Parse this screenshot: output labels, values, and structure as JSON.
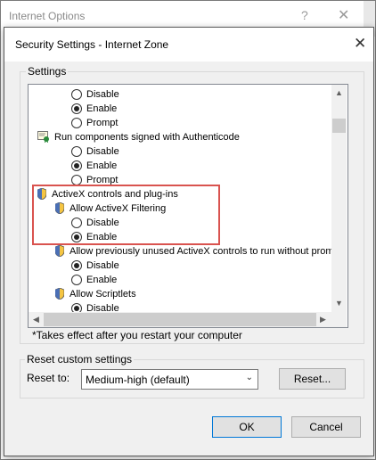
{
  "outer_window": {
    "title": "Internet Options",
    "help_glyph": "?",
    "close_glyph": "✕"
  },
  "dialog": {
    "title": "Security Settings - Internet Zone",
    "close_glyph": "✕"
  },
  "settings_group": {
    "label": "Settings"
  },
  "settings_items": [
    {
      "kind": "radio",
      "label": "Disable",
      "selected": false
    },
    {
      "kind": "radio",
      "label": "Enable",
      "selected": true
    },
    {
      "kind": "radio",
      "label": "Prompt",
      "selected": false
    },
    {
      "kind": "category",
      "label": "Run components signed with Authenticode",
      "icon": "certificate-icon"
    },
    {
      "kind": "radio",
      "label": "Disable",
      "selected": false
    },
    {
      "kind": "radio",
      "label": "Enable",
      "selected": true
    },
    {
      "kind": "radio",
      "label": "Prompt",
      "selected": false
    },
    {
      "kind": "category",
      "label": "ActiveX controls and plug-ins",
      "icon": "shield-icon"
    },
    {
      "kind": "subcategory",
      "label": "Allow ActiveX Filtering",
      "icon": "shield-icon"
    },
    {
      "kind": "radio",
      "label": "Disable",
      "selected": false
    },
    {
      "kind": "radio",
      "label": "Enable",
      "selected": true
    },
    {
      "kind": "subcategory",
      "label": "Allow previously unused ActiveX controls to run without prom",
      "icon": "shield-icon"
    },
    {
      "kind": "radio",
      "label": "Disable",
      "selected": true
    },
    {
      "kind": "radio",
      "label": "Enable",
      "selected": false
    },
    {
      "kind": "subcategory",
      "label": "Allow Scriptlets",
      "icon": "shield-icon"
    },
    {
      "kind": "radio",
      "label": "Disable",
      "selected": true
    }
  ],
  "note": "*Takes effect after you restart your computer",
  "reset_group": {
    "label": "Reset custom settings",
    "reset_to_label": "Reset to:",
    "selected": "Medium-high (default)",
    "reset_button": "Reset..."
  },
  "buttons": {
    "ok": "OK",
    "cancel": "Cancel"
  },
  "colors": {
    "highlight": "#d9534f",
    "ok_border": "#0078d7"
  }
}
